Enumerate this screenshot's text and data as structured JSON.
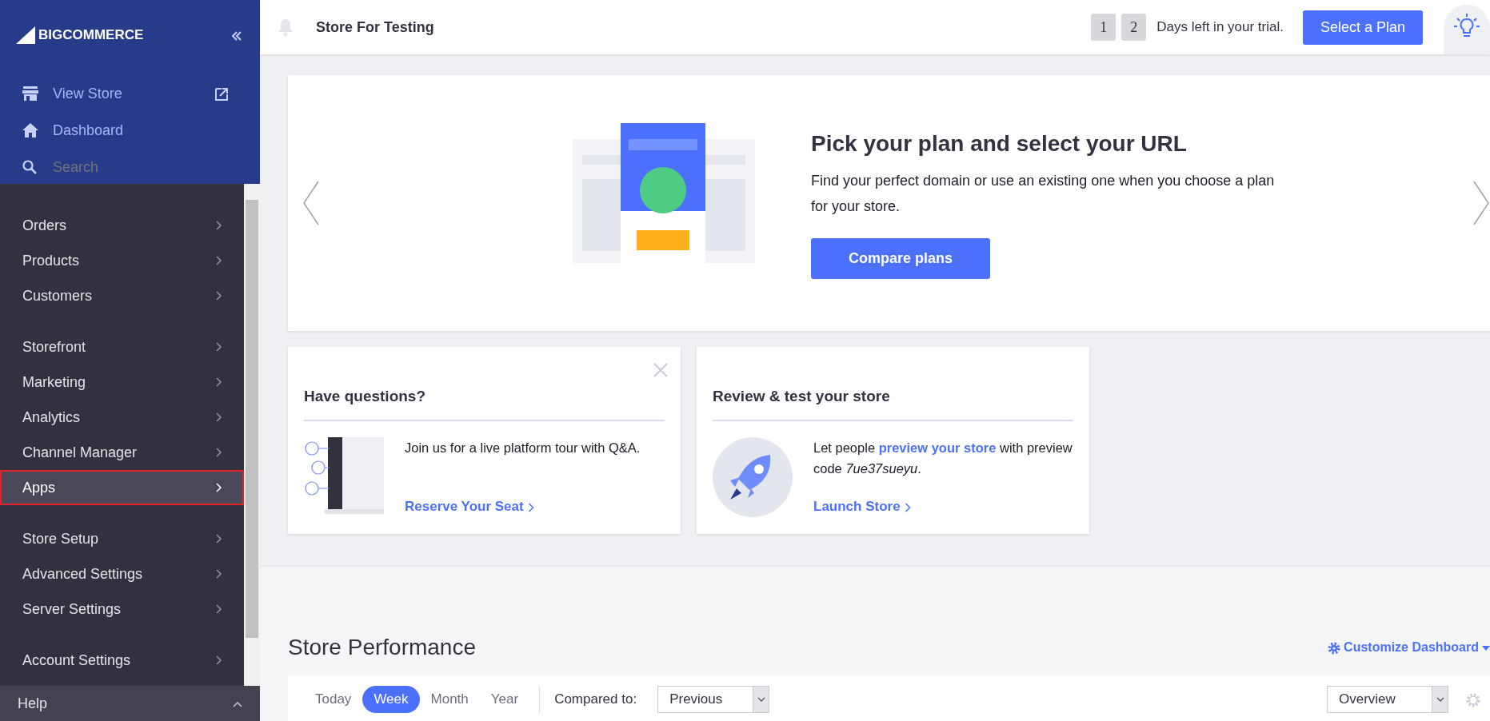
{
  "sidebar": {
    "logo": {
      "big": "BIG",
      "rest": "COMMERCE"
    },
    "top_links": [
      {
        "kind": "store",
        "label": "View Store"
      },
      {
        "kind": "home",
        "label": "Dashboard"
      },
      {
        "kind": "search",
        "placeholder": "Search"
      }
    ],
    "groups": [
      [
        {
          "label": "Orders",
          "selected": false,
          "annotated": false
        },
        {
          "label": "Products",
          "selected": false,
          "annotated": false
        },
        {
          "label": "Customers",
          "selected": false,
          "annotated": false
        }
      ],
      [
        {
          "label": "Storefront",
          "selected": false,
          "annotated": false
        },
        {
          "label": "Marketing",
          "selected": false,
          "annotated": false
        },
        {
          "label": "Analytics",
          "selected": false,
          "annotated": false
        },
        {
          "label": "Channel Manager",
          "selected": false,
          "annotated": false
        },
        {
          "label": "Apps",
          "selected": true,
          "annotated": true
        }
      ],
      [
        {
          "label": "Store Setup",
          "selected": false,
          "annotated": false
        },
        {
          "label": "Advanced Settings",
          "selected": false,
          "annotated": false
        },
        {
          "label": "Server Settings",
          "selected": false,
          "annotated": false
        }
      ],
      [
        {
          "label": "Account Settings",
          "selected": false,
          "annotated": false
        }
      ]
    ],
    "help": "Help"
  },
  "header": {
    "store_name": "Store For Testing",
    "trial_digits": [
      "1",
      "2"
    ],
    "trial_text": "Days left in your trial.",
    "plan_button": "Select a Plan"
  },
  "banner": {
    "title": "Pick your plan and select your URL",
    "text": "Find your perfect domain or use an existing one when you choose a plan for your store.",
    "button": "Compare plans"
  },
  "cards": [
    {
      "kind": "tour",
      "title": "Have questions?",
      "closable": true,
      "text": "Join us for a live platform tour with Q&A.",
      "link": "Reserve Your Seat"
    },
    {
      "kind": "preview",
      "title": "Review & test your store",
      "closable": false,
      "text": "Let people **preview your store** with preview code *7ue37sueyu*.",
      "link": "Launch Store"
    }
  ],
  "performance": {
    "title": "Store Performance",
    "customize": "Customize Dashboard",
    "periods": [
      {
        "label": "Today",
        "selected": false
      },
      {
        "label": "Week",
        "selected": true
      },
      {
        "label": "Month",
        "selected": false
      },
      {
        "label": "Year",
        "selected": false
      }
    ],
    "compared_label": "Compared to:",
    "compared_value": "Previous",
    "view_value": "Overview"
  }
}
